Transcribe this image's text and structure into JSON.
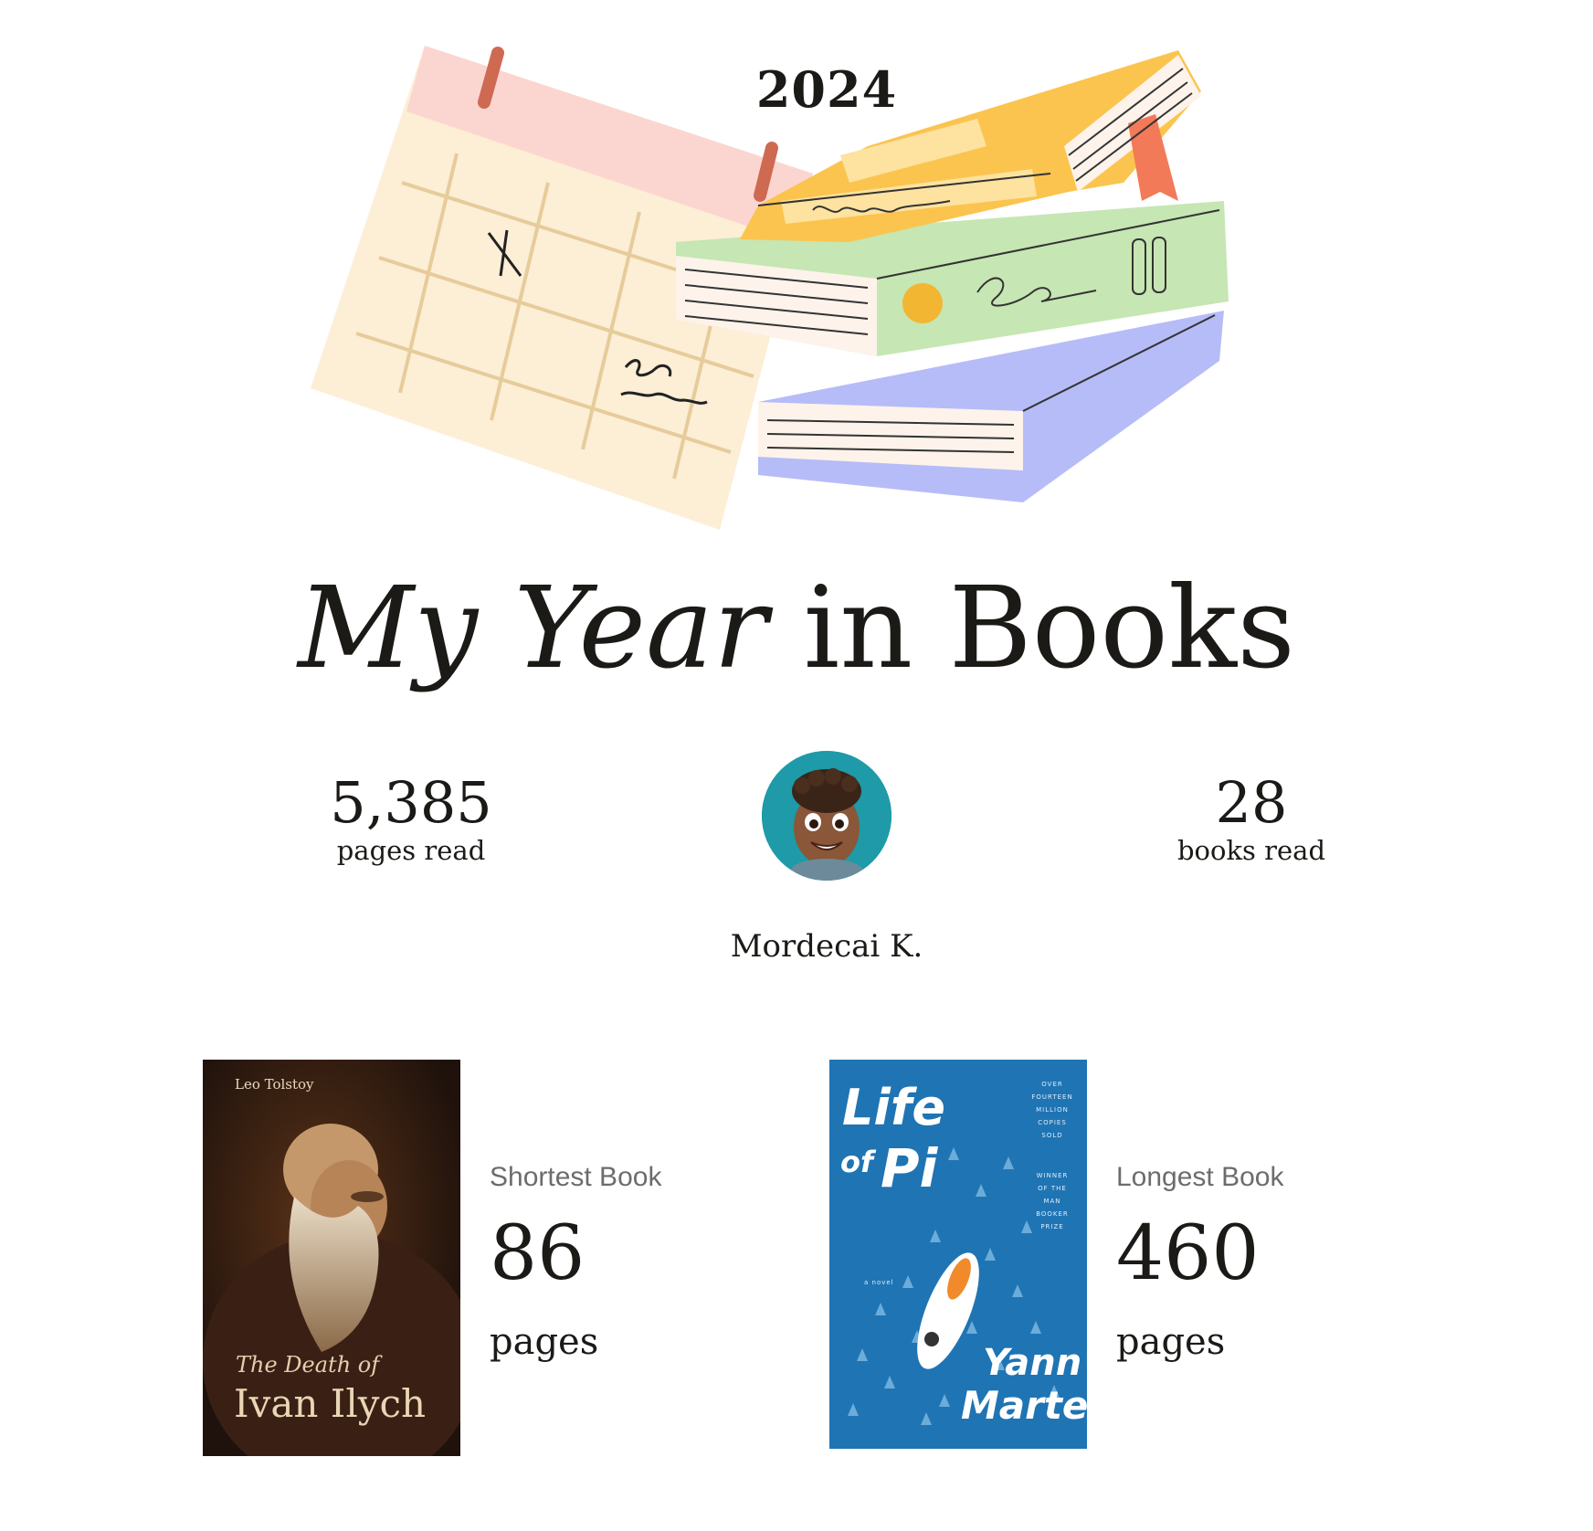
{
  "header": {
    "year": "2024",
    "title_italic": "My Year",
    "title_rest": " in Books"
  },
  "stats": {
    "pages_value": "5,385",
    "pages_label": "pages read",
    "books_value": "28",
    "books_label": "books read"
  },
  "user": {
    "name": "Mordecai K."
  },
  "shortest_book": {
    "category": "Shortest Book",
    "pages_value": "86",
    "pages_unit": "pages",
    "cover": {
      "author": "Leo Tolstoy",
      "subtitle": "The Death of",
      "title": "Ivan Ilych"
    }
  },
  "longest_book": {
    "category": "Longest Book",
    "pages_value": "460",
    "pages_unit": "pages",
    "cover": {
      "title_line1": "Life",
      "title_of": "of",
      "title_pi": "Pi",
      "side_text_top": "OVER\nFOURTEEN\nMILLION\nCOPIES\nSOLD",
      "side_text_bottom": "WINNER\nOF THE\nMAN\nBOOKER\nPRIZE",
      "novel": "a novel",
      "author_first": "Yann",
      "author_last": "Martel"
    }
  },
  "colors": {
    "calendar_top": "#fbd6d0",
    "calendar_body": "#fdeed6",
    "book_yellow": "#fbc44f",
    "book_green": "#c6e6b3",
    "book_blue": "#b6bcf8",
    "avatar_bg": "#1e9aa8",
    "pi_blue": "#1f74b4"
  }
}
